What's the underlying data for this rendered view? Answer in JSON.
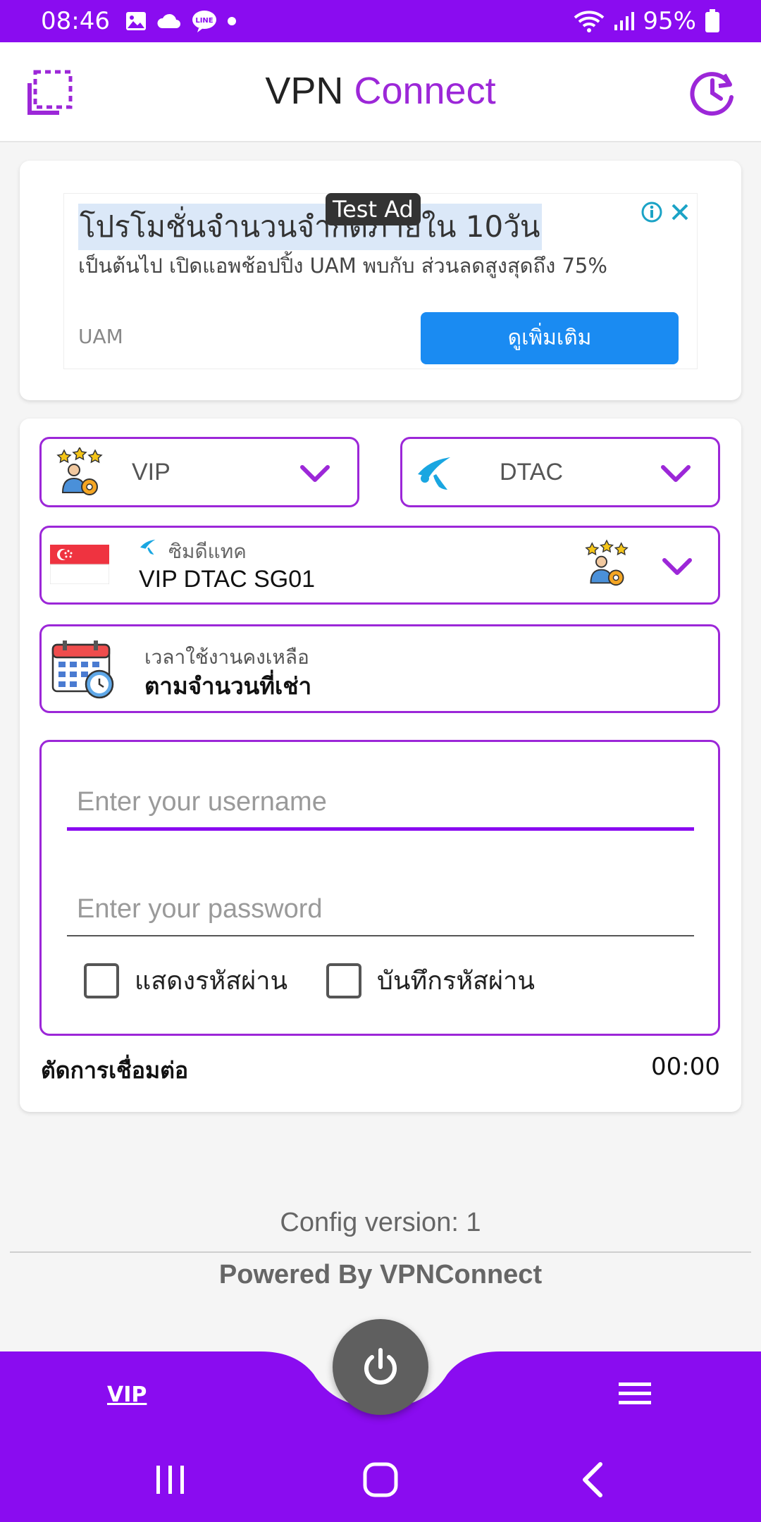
{
  "status_bar": {
    "time": "08:46",
    "battery": "95%",
    "icons": [
      "image-icon",
      "cloud-icon",
      "line-icon",
      "dot-icon",
      "wifi-icon",
      "signal-icon",
      "battery-icon"
    ],
    "bg_color": "#8a0cf0"
  },
  "app_bar": {
    "title_part1": "VPN",
    "title_part2": "Connect",
    "accent_color": "#9c27d8"
  },
  "ad": {
    "badge": "Test Ad",
    "headline": "โปรโมชั่นจำนวนจำกัดภายใน 10วัน",
    "description": "เป็นต้นไป เปิดแอพช้อปปิ้ง UAM พบกับ ส่วนลดสูงสุดถึง 75%",
    "advertiser": "UAM",
    "button": "ดูเพิ่มเติม"
  },
  "selectors": {
    "plan": "VIP",
    "network": "DTAC",
    "server_sublabel": "ซิมดีแทค",
    "server_name": "VIP DTAC SG01",
    "time_label": "เวลาใช้งานคงเหลือ",
    "time_value": "ตามจำนวนที่เช่า"
  },
  "login": {
    "username_placeholder": "Enter your username",
    "password_placeholder": "Enter your password",
    "show_password": "แสดงรหัสผ่าน",
    "save_password": "บันทึกรหัสผ่าน"
  },
  "connection": {
    "status": "ตัดการเชื่อมต่อ",
    "timer": "00:00"
  },
  "footer": {
    "config_version": "Config version: 1",
    "powered_by": "Powered By VPNConnect"
  },
  "bottom_nav": {
    "vip_label": "VIP"
  }
}
